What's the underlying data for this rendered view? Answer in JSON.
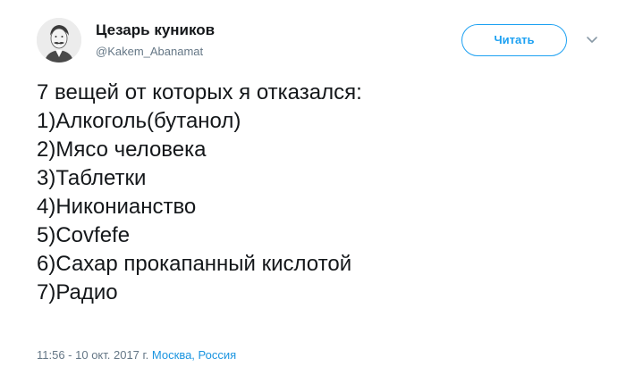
{
  "user": {
    "display_name": "Цезарь куников",
    "handle": "@Kakem_Abanamat"
  },
  "follow_button": {
    "label": "Читать"
  },
  "icons": {
    "avatar": "user-portrait-avatar",
    "caret": "chevron-down-icon"
  },
  "tweet": {
    "lines": [
      "7 вещей от которых я отказался:",
      "1)Алкоголь(бутанол)",
      "2)Мясо человека",
      "3)Таблетки",
      "4)Никонианство",
      "5)Covfefe",
      "6)Сахар прокапанный кислотой",
      "7)Радио"
    ]
  },
  "meta": {
    "timestamp": "11:56 - 10 окт. 2017 г.",
    "location": "Москва, Россия"
  },
  "colors": {
    "accent": "#1da1f2",
    "link": "#1b95e0",
    "muted": "#657786",
    "text": "#14171a"
  }
}
